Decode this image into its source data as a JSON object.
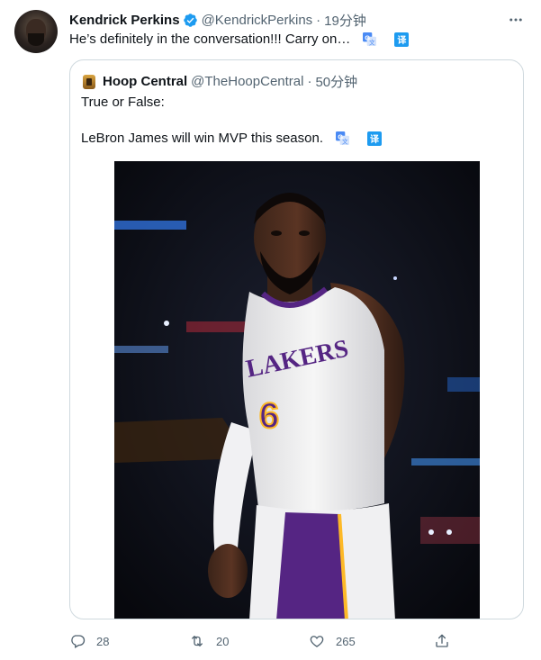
{
  "tweet": {
    "author_name": "Kendrick Perkins",
    "author_handle": "@KendrickPerkins",
    "separator": "·",
    "timestamp": "19分钟",
    "text": "He’s definitely in the conversation!!! Carry on…",
    "translate_badge": "译"
  },
  "quoted_tweet": {
    "author_name": "Hoop Central",
    "author_handle": "@TheHoopCentral",
    "separator": "·",
    "timestamp": "50分钟",
    "line1": "True or False:",
    "line2": "LeBron James will win MVP this season.",
    "translate_badge": "译",
    "jersey_text": "LAKERS",
    "jersey_number": "6"
  },
  "actions": {
    "replies": "28",
    "retweets": "20",
    "likes": "265"
  },
  "colors": {
    "accent": "#1d9bf0",
    "text": "#0f1419",
    "muted": "#536471",
    "border": "#cfd9de",
    "lakers_purple": "#552583",
    "lakers_gold": "#fdb927"
  },
  "icons": [
    "verified-badge-icon",
    "more-icon",
    "translate-icon",
    "reply-icon",
    "retweet-icon",
    "like-icon",
    "share-icon"
  ]
}
